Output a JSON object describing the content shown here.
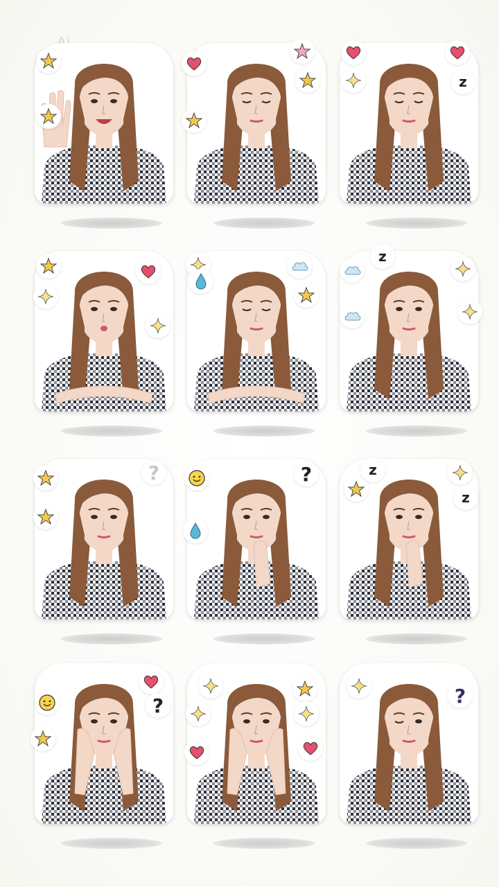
{
  "watermark": "Ai",
  "colors": {
    "hair": "#8a5a3a",
    "skin": "#f3d8c8",
    "shirt_dark": "#2d2f3a",
    "shirt_light": "#f4f4f4",
    "heart": "#e6506e",
    "star": "#f2c94c",
    "drop": "#5bb7d6",
    "cloud": "#cfe6f3"
  },
  "stickers": [
    {
      "id": "wave",
      "pose": "waving-hand",
      "expression": "big-smile",
      "decorations": [
        "star-icon",
        "star-icon"
      ]
    },
    {
      "id": "eyes-closed",
      "pose": "shoulders",
      "expression": "eyes-closed-smile",
      "decorations": [
        "heart-icon",
        "pink-star-icon",
        "star-icon",
        "star-icon"
      ]
    },
    {
      "id": "sleepy",
      "pose": "shoulders",
      "expression": "sleepy",
      "decorations": [
        "heart-icon",
        "sparkle-icon",
        "heart-icon",
        "zzz-icon"
      ]
    },
    {
      "id": "kiss",
      "pose": "arms-crossed",
      "expression": "pout-kiss",
      "decorations": [
        "star-icon",
        "sparkle-icon",
        "heart-icon",
        "sparkle-icon"
      ]
    },
    {
      "id": "sulk",
      "pose": "arms-crossed",
      "expression": "sulk",
      "decorations": [
        "sparkle-icon",
        "drop-icon",
        "cloud-icon",
        "star-icon"
      ]
    },
    {
      "id": "dreamy",
      "pose": "shoulders",
      "expression": "dreamy",
      "decorations": [
        "cloud-icon",
        "zzz-icon",
        "cloud-icon",
        "sparkle-icon",
        "sparkle-icon"
      ]
    },
    {
      "id": "smug",
      "pose": "shoulders",
      "expression": "smug",
      "decorations": [
        "star-icon",
        "star-icon",
        "question-icon"
      ]
    },
    {
      "id": "thinking",
      "pose": "hand-on-chin",
      "expression": "puzzled",
      "decorations": [
        "smiley-icon",
        "drop-icon",
        "question-icon"
      ]
    },
    {
      "id": "pondering",
      "pose": "hand-on-chin",
      "expression": "pondering",
      "decorations": [
        "zzz-icon",
        "star-icon",
        "sparkle-icon",
        "zzz-icon"
      ]
    },
    {
      "id": "cheeks",
      "pose": "hands-on-cheeks",
      "expression": "neutral",
      "decorations": [
        "smiley-icon",
        "star-icon",
        "heart-icon",
        "question-icon"
      ]
    },
    {
      "id": "cheeks-cute",
      "pose": "hands-on-cheeks",
      "expression": "cute",
      "decorations": [
        "sparkle-icon",
        "sparkle-icon",
        "heart-icon",
        "star-icon",
        "sparkle-icon",
        "heart-icon"
      ]
    },
    {
      "id": "wink",
      "pose": "shoulders",
      "expression": "wink",
      "decorations": [
        "sparkle-icon",
        "question-icon"
      ]
    }
  ],
  "labels": {
    "question": "?",
    "zzz": "z"
  }
}
